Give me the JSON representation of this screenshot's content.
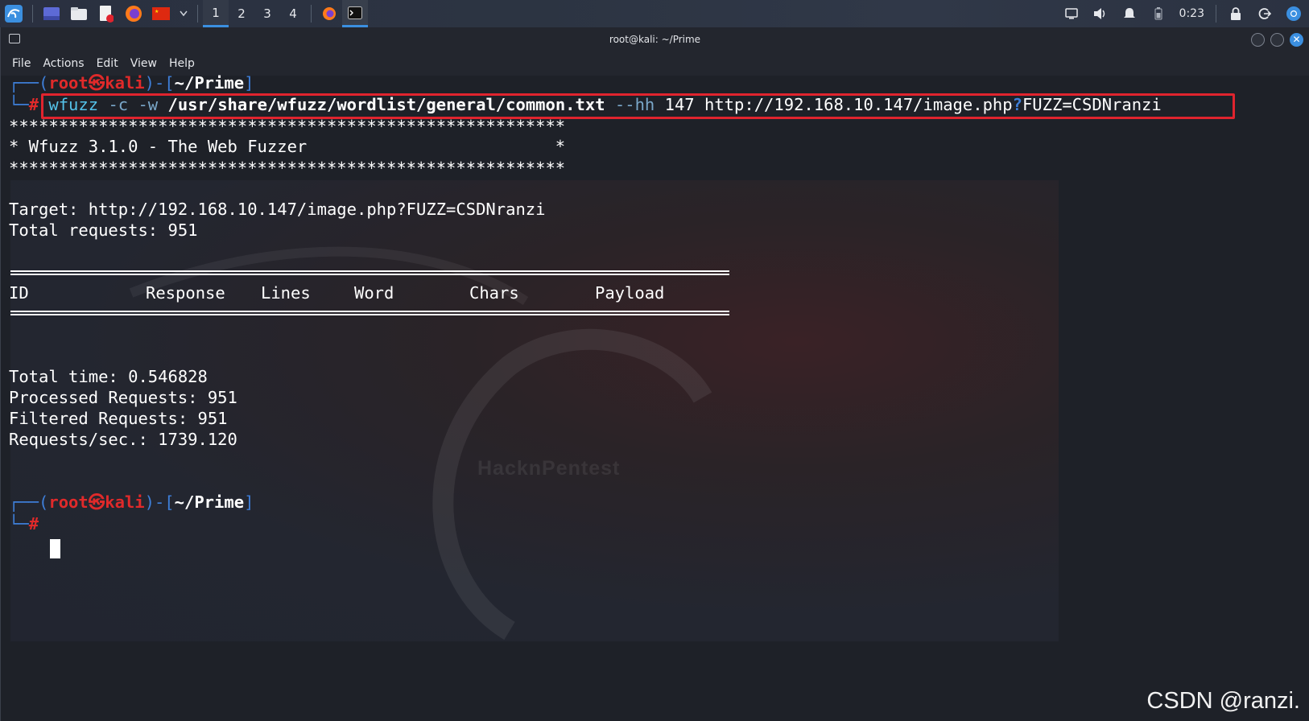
{
  "taskbar": {
    "workspaces": [
      "1",
      "2",
      "3",
      "4"
    ],
    "active_workspace": "1",
    "clock": "0:23"
  },
  "window": {
    "title": "root@kali: ~/Prime",
    "menu": [
      "File",
      "Actions",
      "Edit",
      "View",
      "Help"
    ]
  },
  "terminal": {
    "prompt1": {
      "open": "┌──(",
      "user": "root",
      "skull": "㉿",
      "host": "kali",
      "mid": ")-[",
      "path": "~/Prime",
      "close": "]"
    },
    "cmd_prefix": "└─",
    "hash": "#",
    "command": {
      "tool": "wfuzz",
      "opt_c": "-c",
      "opt_w": "-w",
      "wordlist": "/usr/share/wfuzz/wordlist/general/common.txt",
      "opt_hh": "--hh",
      "hh_value": "147",
      "url_a": "http://192.168.10.147/image.php",
      "qmark": "?",
      "url_b": "FUZZ=CSDNranzi"
    },
    "banner_stars": "********************************************************",
    "banner_title": "* Wfuzz 3.1.0 - The Web Fuzzer                         *",
    "target": "Target: http://192.168.10.147/image.php?FUZZ=CSDNranzi",
    "total_requests": "Total requests: 951",
    "columns": [
      "ID",
      "Response",
      "Lines",
      "Word",
      "Chars",
      "Payload"
    ],
    "total_time": "Total time: 0.546828",
    "processed": "Processed Requests: 951",
    "filtered": "Filtered Requests: 951",
    "rps": "Requests/sec.: 1739.120",
    "prompt2": {
      "open": "┌──(",
      "user": "root",
      "skull": "㉿",
      "host": "kali",
      "mid": ")-[",
      "path": "~/Prime",
      "close": "]"
    },
    "bg_logo": "HacknPentest"
  },
  "watermark": "CSDN @ranzi."
}
